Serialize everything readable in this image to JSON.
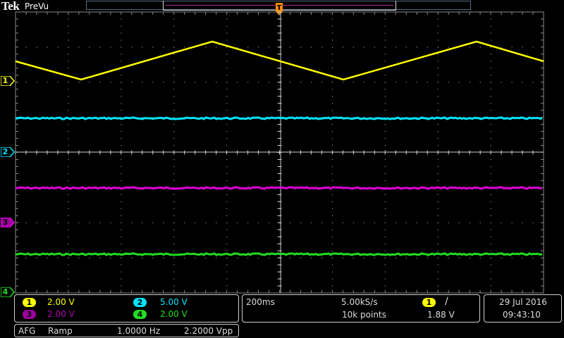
{
  "header": {
    "brand": "Tek",
    "acq_state": "PreVu"
  },
  "colors": {
    "ch1": "#ffff00",
    "ch2": "#00e5ff",
    "ch3": "#e000d8",
    "ch4": "#22dd22",
    "trigger": "#ff8c00",
    "graticule": "#8a8a8a"
  },
  "channels": [
    {
      "id": "1",
      "scale": "2.00 V",
      "waveform": "ramp"
    },
    {
      "id": "2",
      "scale": "5.00 V",
      "waveform": "flat"
    },
    {
      "id": "3",
      "scale": "2.00 V",
      "waveform": "flat"
    },
    {
      "id": "4",
      "scale": "2.00 V",
      "waveform": "flat"
    }
  ],
  "horizontal": {
    "timebase": "200ms",
    "sample_rate": "5.00kS/s",
    "record_length": "10k points"
  },
  "trigger": {
    "source": "1",
    "slope_symbol": "∕",
    "level": "1.88 V",
    "marker_label": "T"
  },
  "datetime": {
    "date": "29 Jul  2016",
    "time": "09:43:10"
  },
  "afg": {
    "label": "AFG",
    "waveform": "Ramp",
    "frequency": "1.0000 Hz",
    "amplitude": "2.2000 Vpp"
  }
}
